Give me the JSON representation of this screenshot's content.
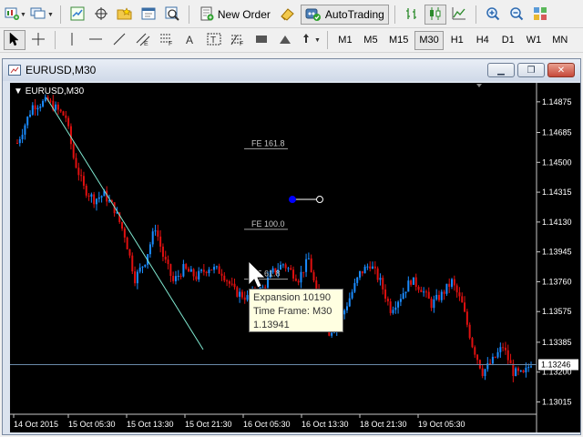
{
  "toolbar": {
    "new_order_label": "New Order",
    "autotrading_label": "AutoTrading",
    "timeframes": [
      "M1",
      "M5",
      "M15",
      "M30",
      "H1",
      "H4",
      "D1",
      "W1",
      "MN"
    ],
    "selected_timeframe": "M30"
  },
  "window": {
    "title": "EURUSD,M30"
  },
  "chart": {
    "symbol_label": "EURUSD,M30",
    "current_price": "1.13246",
    "fe_levels": [
      {
        "label": "FE 161.8",
        "value": 1.14584
      },
      {
        "label": "FE 100.0",
        "value": 1.14085
      },
      {
        "label": "FE 61.8",
        "value": 1.13776
      }
    ],
    "tooltip": {
      "line1": "Expansion 10190",
      "line2": "Time Frame: M30",
      "line3": "1.13941"
    },
    "colors": {
      "up": "#1a8cff",
      "down": "#e01010",
      "background": "#000000",
      "price_line": "#6a8aa8",
      "trend_line": "#7fe8d0"
    }
  },
  "chart_data": {
    "type": "candlestick",
    "symbol": "EURUSD",
    "timeframe": "M30",
    "ylim": [
      1.1295,
      1.1497
    ],
    "y_ticks": [
      "1.14875",
      "1.14685",
      "1.14500",
      "1.14315",
      "1.14130",
      "1.13945",
      "1.13760",
      "1.13575",
      "1.13385",
      "1.13200",
      "1.13015"
    ],
    "y_tick_values": [
      1.14875,
      1.14685,
      1.145,
      1.14315,
      1.1413,
      1.13945,
      1.1376,
      1.13575,
      1.13385,
      1.132,
      1.13015
    ],
    "x_ticks": [
      "14 Oct 2015",
      "15 Oct 05:30",
      "15 Oct 13:30",
      "15 Oct 21:30",
      "16 Oct 05:30",
      "16 Oct 13:30",
      "18 Oct 21:30",
      "19 Oct 05:30"
    ],
    "last_price": 1.13246,
    "close_path": [
      [
        0,
        1.1462
      ],
      [
        6,
        1.1485
      ],
      [
        12,
        1.1488
      ],
      [
        16,
        1.1482
      ],
      [
        19,
        1.1478
      ],
      [
        22,
        1.1453
      ],
      [
        26,
        1.1434
      ],
      [
        30,
        1.1427
      ],
      [
        34,
        1.143
      ],
      [
        38,
        1.1421
      ],
      [
        42,
        1.1405
      ],
      [
        46,
        1.1378
      ],
      [
        50,
        1.1389
      ],
      [
        54,
        1.141
      ],
      [
        57,
        1.1392
      ],
      [
        61,
        1.1376
      ],
      [
        65,
        1.1384
      ],
      [
        70,
        1.1379
      ],
      [
        75,
        1.1385
      ],
      [
        80,
        1.1382
      ],
      [
        85,
        1.137
      ],
      [
        90,
        1.1366
      ],
      [
        96,
        1.1372
      ],
      [
        100,
        1.1382
      ],
      [
        104,
        1.1387
      ],
      [
        110,
        1.1378
      ],
      [
        114,
        1.139
      ],
      [
        118,
        1.1362
      ],
      [
        122,
        1.1345
      ],
      [
        126,
        1.1351
      ],
      [
        130,
        1.1366
      ],
      [
        134,
        1.1381
      ],
      [
        138,
        1.1387
      ],
      [
        142,
        1.1376
      ],
      [
        146,
        1.1359
      ],
      [
        150,
        1.1367
      ],
      [
        154,
        1.1377
      ],
      [
        158,
        1.1372
      ],
      [
        162,
        1.1362
      ],
      [
        166,
        1.1368
      ],
      [
        170,
        1.1376
      ],
      [
        174,
        1.1362
      ],
      [
        178,
        1.1337
      ],
      [
        182,
        1.132
      ],
      [
        186,
        1.1327
      ],
      [
        190,
        1.1336
      ],
      [
        194,
        1.132
      ],
      [
        198,
        1.1318
      ],
      [
        201,
        1.1326
      ]
    ]
  }
}
